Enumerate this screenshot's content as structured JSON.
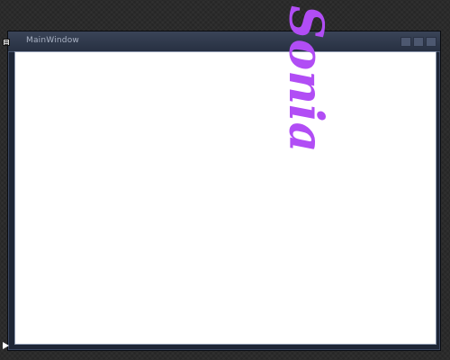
{
  "window": {
    "title": "MainWindow"
  },
  "watermark": {
    "text": "Sonia",
    "color": "#b14df5"
  },
  "icons": {
    "system_menu": "window-menu-icon",
    "minimize": "minimize-icon",
    "maximize": "maximize-icon",
    "close": "close-icon",
    "resize": "resize-grip-icon"
  }
}
